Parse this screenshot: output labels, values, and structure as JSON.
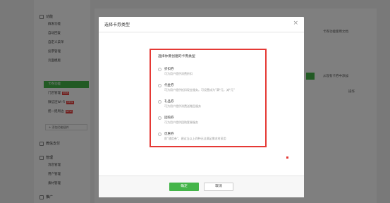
{
  "sidebar": {
    "group_function": "功能",
    "group_mgmt": "管理",
    "group_promo": "推广",
    "items": [
      {
        "label": "群发功能"
      },
      {
        "label": "自动回复"
      },
      {
        "label": "自定义菜单"
      },
      {
        "label": "投票管理"
      },
      {
        "label": "页面模版"
      },
      {
        "label": "卡券功能",
        "active": true
      },
      {
        "label": "门店管理",
        "badge": "NEW"
      },
      {
        "label": "微信连Wi-Fi",
        "badge": "NEW"
      },
      {
        "label": "摇一摇周边",
        "badge": "NEW"
      }
    ],
    "collapse_label": "+ 添加功能插件",
    "group_pay": "微信支付",
    "mgmt_items": [
      {
        "label": "消息管理"
      },
      {
        "label": "用户管理"
      },
      {
        "label": "素材管理"
      }
    ]
  },
  "background": {
    "top_right_text": "卡券功能使用文档",
    "right_text_2": "从现有卡券中添加",
    "col_action": "操作"
  },
  "dialog": {
    "title": "选择卡券类型",
    "close_icon": "close-icon",
    "prompt": "选择你要创建的卡券类型",
    "options": [
      {
        "name": "折扣券",
        "desc": "可为用户提供消费折扣"
      },
      {
        "name": "代金券",
        "desc": "可为用户提供抵扣现金服务。可设置成为\"满*元，减*元\""
      },
      {
        "name": "礼品券",
        "desc": "可为用户提供消费送赠品服务"
      },
      {
        "name": "团购券",
        "desc": "可为用户提供团购套餐服务"
      },
      {
        "name": "优惠券",
        "desc": "即\"通用券\"，建议当以上四种无法满足需求时采用"
      }
    ],
    "confirm_label": "确定",
    "cancel_label": "取消"
  },
  "colors": {
    "accent": "#44b549",
    "highlight": "#e53935"
  }
}
